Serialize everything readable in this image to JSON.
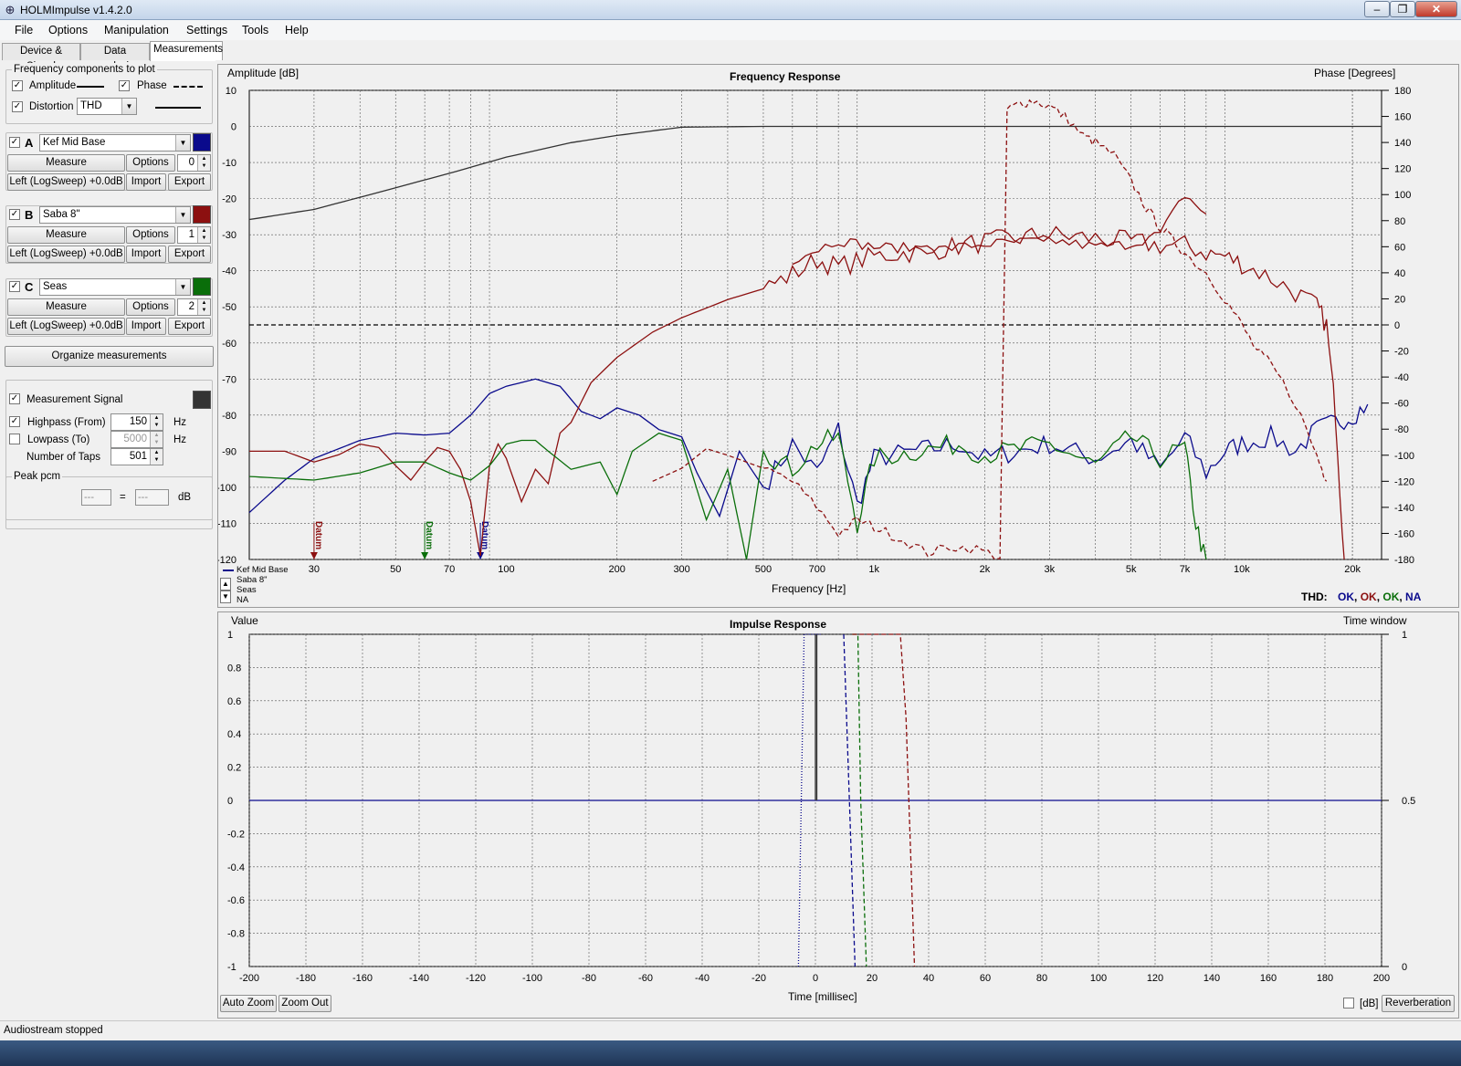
{
  "window": {
    "title": "HOLMImpulse  v1.4.2.0",
    "icon": "app-icon",
    "controls": [
      "minimize-icon",
      "restore-icon",
      "close-icon"
    ]
  },
  "menu": [
    "File",
    "Options",
    "Manipulation",
    "Settings",
    "Tools",
    "Help"
  ],
  "tabs": [
    {
      "label": "Device & Signal"
    },
    {
      "label": "Data analysis"
    },
    {
      "label": "Measurements"
    }
  ],
  "freq_components": {
    "title": "Frequency components to plot",
    "amplitude": "Amplitude",
    "phase": "Phase",
    "distortion": "Distortion",
    "distortion_type": "THD"
  },
  "measurements": [
    {
      "letter": "A",
      "name": "Kef Mid Base",
      "color": "#0a0a8c",
      "measure": "Measure",
      "options": "Options",
      "index": "0",
      "channel": "Left (LogSweep) +0.0dB",
      "import": "Import",
      "export": "Export"
    },
    {
      "letter": "B",
      "name": "Saba 8\"",
      "color": "#8c1010",
      "measure": "Measure",
      "options": "Options",
      "index": "1",
      "channel": "Left (LogSweep) +0.0dB",
      "import": "Import",
      "export": "Export"
    },
    {
      "letter": "C",
      "name": "Seas",
      "color": "#0a6e0a",
      "measure": "Measure",
      "options": "Options",
      "index": "2",
      "channel": "Left (LogSweep) +0.0dB",
      "import": "Import",
      "export": "Export"
    }
  ],
  "organize": "Organize measurements",
  "signal": {
    "label": "Measurement Signal",
    "color": "#333333",
    "highpass": "Highpass (From)",
    "highpass_value": "150",
    "lowpass": "Lowpass (To)",
    "lowpass_value": "5000",
    "taps": "Number of Taps",
    "taps_value": "501",
    "hz": "Hz"
  },
  "peak": {
    "title": "Peak pcm",
    "left": "---",
    "eq": "=",
    "right": "---",
    "unit": "dB"
  },
  "chart_data": [
    {
      "type": "line",
      "title": "Frequency Response",
      "ylabel": "Amplitude [dB]",
      "y2label": "Phase [Degrees]",
      "xlabel": "Frequency [Hz]",
      "xscale": "log",
      "xlim": [
        20,
        24000
      ],
      "ylim": [
        -120,
        10
      ],
      "y2lim": [
        -180,
        180
      ],
      "x_ticks": [
        "30",
        "50",
        "70",
        "100",
        "200",
        "300",
        "500",
        "700",
        "1k",
        "2k",
        "3k",
        "5k",
        "7k",
        "10k",
        "20k"
      ],
      "y_ticks": [
        "10",
        "0",
        "-10",
        "-20",
        "-30",
        "-40",
        "-50",
        "-60",
        "-70",
        "-80",
        "-90",
        "-100",
        "-110",
        "-120"
      ],
      "y2_ticks": [
        "180",
        "160",
        "140",
        "120",
        "100",
        "80",
        "60",
        "40",
        "20",
        "0",
        "-20",
        "-40",
        "-60",
        "-80",
        "-100",
        "-120",
        "-140",
        "-160",
        "-180"
      ],
      "grid": true,
      "legend": {
        "position": "bottom-left",
        "entries": [
          "Kef Mid Base",
          "Saba 8\"",
          "Seas",
          "NA"
        ]
      },
      "markers": [
        {
          "label": "Datum",
          "x": 30,
          "color": "#8c1010"
        },
        {
          "label": "Datum",
          "x": 60,
          "color": "#0a6e0a"
        },
        {
          "label": "Datum",
          "x": 85,
          "color": "#0a0a8c"
        }
      ],
      "thd_status": {
        "label": "THD:",
        "values": [
          {
            "text": "OK",
            "color": "#0a0a8c"
          },
          {
            "text": "OK",
            "color": "#8c1010"
          },
          {
            "text": "OK",
            "color": "#0a6e0a"
          },
          {
            "text": "NA",
            "color": "#0a0a8c"
          }
        ]
      },
      "series": [
        {
          "name": "Measurement Signal",
          "color": "#333333",
          "style": "solid",
          "x": [
            20,
            30,
            50,
            70,
            100,
            150,
            200,
            300,
            500,
            1000,
            24000
          ],
          "y": [
            -25.8,
            -23,
            -17,
            -13,
            -8.5,
            -4.5,
            -2.5,
            -0.2,
            0,
            0,
            0
          ]
        },
        {
          "name": "Kef Mid Base",
          "color": "#0a0a8c",
          "style": "solid",
          "x": [
            20,
            25,
            30,
            40,
            50,
            60,
            70,
            80,
            90,
            100,
            120,
            140,
            160,
            180,
            200,
            230,
            260,
            300,
            330,
            380,
            430,
            500,
            600,
            700,
            800,
            900,
            1000,
            1300,
            1700,
            2000,
            3000,
            4000,
            5000,
            6000,
            7000,
            8000,
            9000,
            10000,
            12000,
            14000,
            16000,
            18000,
            20000,
            22000
          ],
          "y": [
            -107,
            -98,
            -92,
            -87,
            -85,
            -85.5,
            -85,
            -80,
            -74,
            -72,
            -70,
            -72,
            -79,
            -81,
            -78,
            -80,
            -84,
            -86,
            -96,
            -108,
            -90,
            -100,
            -88,
            -96,
            -84,
            -105,
            -92,
            -90,
            -88,
            -92,
            -88,
            -92,
            -87,
            -95,
            -86,
            -96,
            -90,
            -88,
            -86,
            -90,
            -84,
            -82,
            -80,
            -77
          ]
        },
        {
          "name": "Saba 8\"",
          "color": "#8c1010",
          "style": "solid",
          "x": [
            20,
            25,
            30,
            35,
            40,
            45,
            50,
            55,
            60,
            65,
            70,
            75,
            80,
            85,
            90,
            95,
            100,
            110,
            120,
            130,
            140,
            150,
            170,
            200,
            250,
            300,
            400,
            500,
            600,
            700,
            800,
            1000,
            1500,
            2000,
            3000,
            4000,
            5000,
            6000,
            7000,
            8000,
            9000,
            10000,
            12000,
            14000,
            16000,
            17000,
            18000,
            19000
          ],
          "y": [
            -90,
            -90,
            -93,
            -91,
            -88,
            -89,
            -94,
            -98,
            -93,
            -89,
            -90,
            -95,
            -104,
            -119,
            -94,
            -88,
            -92,
            -104,
            -95,
            -99,
            -85,
            -82,
            -71,
            -64,
            -57,
            -53,
            -48,
            -45,
            -41,
            -37,
            -39,
            -36,
            -34,
            -32,
            -30,
            -31,
            -32,
            -33,
            -33,
            -35,
            -36,
            -38,
            -42,
            -46,
            -50,
            -55,
            -80,
            -120
          ]
        },
        {
          "name": "Seas",
          "color": "#0a6e0a",
          "style": "solid",
          "x": [
            20,
            30,
            40,
            50,
            60,
            70,
            80,
            90,
            100,
            110,
            120,
            130,
            150,
            180,
            200,
            220,
            260,
            300,
            350,
            400,
            450,
            500,
            600,
            700,
            800,
            900,
            1000,
            1300,
            1700,
            2000,
            3000,
            4000,
            5000,
            6000,
            7000,
            7500,
            8000
          ],
          "y": [
            -97,
            -98,
            -96,
            -93,
            -93,
            -96,
            -98,
            -94,
            -88,
            -87,
            -87,
            -90,
            -95,
            -93,
            -102,
            -90,
            -85,
            -87,
            -109,
            -95,
            -120,
            -90,
            -95,
            -88,
            -86,
            -110,
            -92,
            -90,
            -88,
            -91,
            -88,
            -94,
            -86,
            -92,
            -89,
            -110,
            -121
          ]
        },
        {
          "name": "Saba 8\" Phase",
          "color": "#8c1010",
          "style": "dashed",
          "axis": "y2",
          "x": [
            250,
            300,
            350,
            400,
            500,
            600,
            700,
            800,
            900,
            1000,
            1200,
            1400,
            1600,
            1900,
            2200,
            2300,
            2500,
            2700,
            3000,
            3300,
            3700,
            4000,
            4500,
            5000,
            5500,
            6000,
            6500,
            7000,
            8000,
            9000,
            10000,
            11000,
            12000,
            14000,
            16000,
            17000
          ],
          "y": [
            -120,
            -110,
            -95,
            -100,
            -110,
            -120,
            -140,
            -160,
            -150,
            -155,
            -165,
            -175,
            -170,
            -172,
            -178,
            165,
            170,
            172,
            168,
            160,
            145,
            140,
            130,
            110,
            90,
            75,
            65,
            55,
            40,
            20,
            0,
            -20,
            -30,
            -60,
            -100,
            -120
          ]
        },
        {
          "name": "Seas Phase",
          "color": "#8c1010",
          "style": "solid",
          "axis": "y2",
          "x": [
            600,
            800,
            1000,
            1500,
            2000,
            3000,
            4000,
            5000,
            6000,
            7000,
            8000
          ],
          "y": [
            50,
            65,
            60,
            58,
            62,
            65,
            60,
            62,
            70,
            100,
            85
          ]
        }
      ]
    },
    {
      "type": "line",
      "title": "Impulse Response",
      "ylabel": "Value",
      "y2label": "Time window",
      "xlabel": "Time [millisec]",
      "xlim": [
        -200,
        200
      ],
      "ylim": [
        -1,
        1
      ],
      "y2lim": [
        0,
        1
      ],
      "x_ticks": [
        "-200",
        "-180",
        "-160",
        "-140",
        "-120",
        "-100",
        "-80",
        "-60",
        "-40",
        "-20",
        "0",
        "20",
        "40",
        "60",
        "80",
        "100",
        "120",
        "140",
        "160",
        "180",
        "200"
      ],
      "y_ticks": [
        "1",
        "0.8",
        "0.6",
        "0.4",
        "0.2",
        "0",
        "-0.2",
        "-0.4",
        "-0.6",
        "-0.8",
        "-1"
      ],
      "y2_ticks": [
        "1",
        "0.5",
        "0"
      ],
      "grid": true,
      "series": [
        {
          "name": "Impulse",
          "color": "#0a0a8c",
          "style": "solid",
          "x": [
            -200,
            200
          ],
          "y": [
            0,
            0
          ]
        },
        {
          "name": "Measurement window",
          "color": "#333333",
          "style": "solid",
          "x": [
            0,
            0,
            0.5,
            0.5
          ],
          "y": [
            0,
            1,
            1,
            0
          ]
        },
        {
          "name": "Kef Mid Base window",
          "color": "#0a0a8c",
          "style": "dotted",
          "x": [
            -6,
            -4,
            0,
            2
          ],
          "y": [
            -1,
            1,
            1,
            1
          ]
        },
        {
          "name": "Kef Mid Base window end",
          "color": "#0a0a8c",
          "style": "dashed",
          "x": [
            10,
            12,
            14
          ],
          "y": [
            1,
            0,
            -1
          ]
        },
        {
          "name": "Seas window",
          "color": "#0a6e0a",
          "style": "dashed",
          "x": [
            13,
            15,
            16,
            17,
            18
          ],
          "y": [
            1,
            1,
            0,
            -0.5,
            -1
          ]
        },
        {
          "name": "Saba 8\" window",
          "color": "#8c1010",
          "style": "dashed",
          "x": [
            13,
            30,
            32,
            33,
            35
          ],
          "y": [
            1,
            1,
            0.5,
            0,
            -1
          ]
        }
      ]
    }
  ],
  "impulse_controls": {
    "auto_zoom": "Auto Zoom",
    "zoom_out": "Zoom Out",
    "db": "[dB]",
    "reverberation": "Reverberation"
  },
  "status": "Audiostream stopped"
}
